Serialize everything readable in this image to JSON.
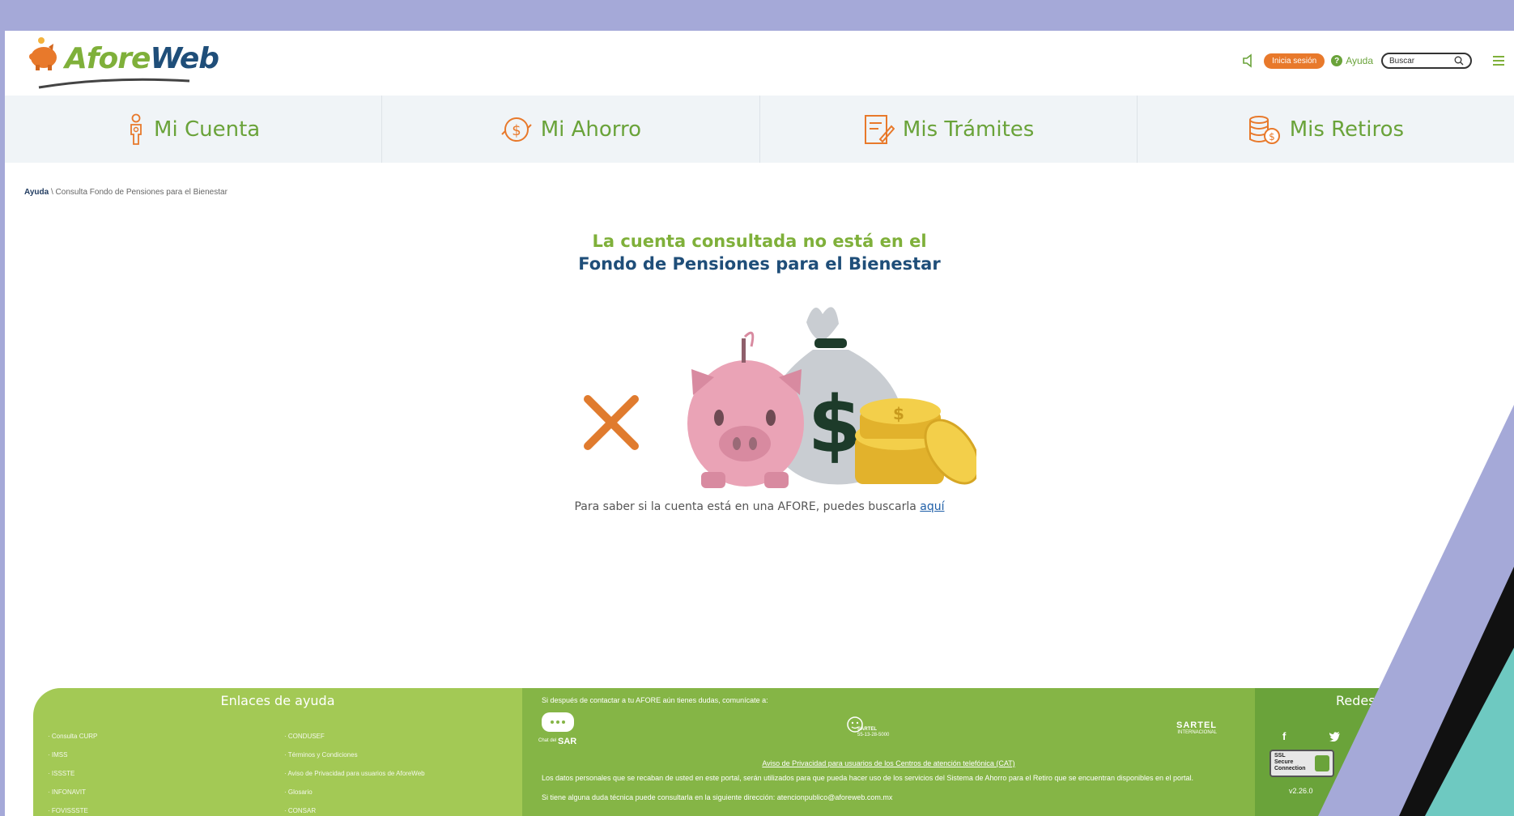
{
  "header": {
    "logo_text_a": "Afore",
    "logo_text_b": "Web",
    "login_label": "Inicia sesión",
    "help_label": "Ayuda",
    "help_glyph": "?",
    "search_placeholder": "Buscar"
  },
  "nav": {
    "items": [
      {
        "label": "Mi Cuenta",
        "icon": "person-icon"
      },
      {
        "label": "Mi Ahorro",
        "icon": "coin-hand-icon"
      },
      {
        "label": "Mis Trámites",
        "icon": "document-edit-icon"
      },
      {
        "label": "Mis Retiros",
        "icon": "coins-stack-icon"
      }
    ]
  },
  "breadcrumb": {
    "root": "Ayuda",
    "separator": "\\",
    "current": "Consulta Fondo de Pensiones para el Bienestar"
  },
  "main": {
    "title_line1": "La cuenta consultada no está en el",
    "title_line2": "Fondo de Pensiones para el Bienestar",
    "info_text": "Para saber si la cuenta está en una AFORE, puedes buscarla ",
    "info_link": "aquí"
  },
  "footer": {
    "help_links_title": "Enlaces de ayuda",
    "links_left": [
      "Consulta CURP",
      "IMSS",
      "ISSSTE",
      "INFONAVIT",
      "FOVISSSTE"
    ],
    "links_right": [
      "CONDUSEF",
      "Términos y Condiciones",
      "Aviso de Privacidad para usuarios de AforeWeb",
      "Glosario",
      "CONSAR"
    ],
    "contact_text": "Si después de contactar a tu AFORE aún tienes dudas, comunícate a:",
    "chat_label": "SAR",
    "chat_small": "Chat del",
    "sartel_label": "SARTEL",
    "sartel_phone": "55-13-28-5000",
    "sartel_intl": "SARTEL",
    "sartel_intl_small": "INTERNACIONAL",
    "privacy_link": "Aviso de Privacidad para usuarios de los Centros de atención telefónica (CAT)",
    "data_notice": "Los datos personales que se recaban de usted en este portal, serán utilizados para que pueda hacer uso de los servicios del Sistema de Ahorro para el Retiro que se encuentran disponibles en el portal.",
    "tech_notice": "Si tiene alguna duda técnica puede consultarla en la siguiente dirección: atencionpublico@aforeweb.com.mx",
    "social_title": "Redes",
    "social_f": "f",
    "ssl_text1": "SSL",
    "ssl_text2": "Secure",
    "ssl_text3": "Connection",
    "version": "v2.26.0"
  },
  "colors": {
    "green": "#7fb03a",
    "navy": "#1f4e79",
    "orange": "#e8792b",
    "lavender": "#a5a9d8"
  }
}
